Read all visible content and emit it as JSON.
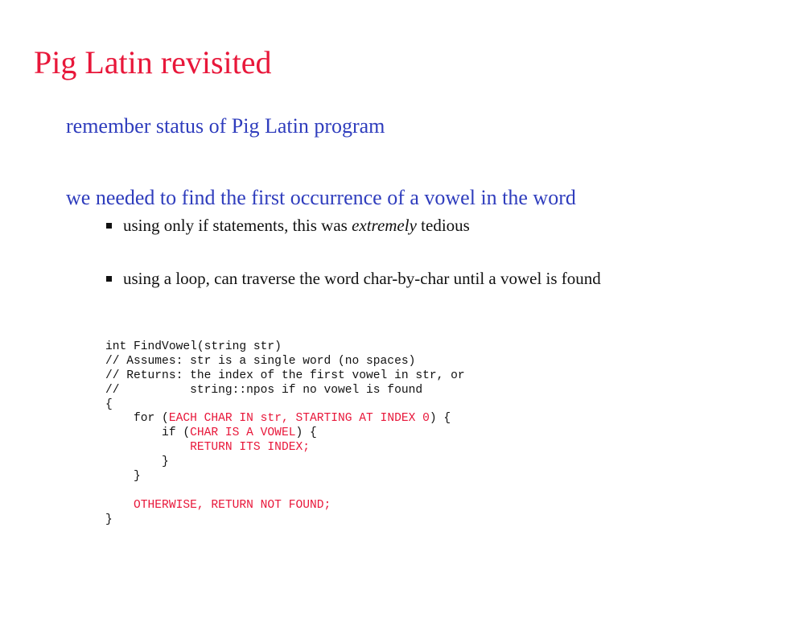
{
  "slide": {
    "title": "Pig Latin revisited",
    "bullets": [
      "remember status of Pig Latin program",
      "we needed to find the first occurrence of a vowel in the word"
    ],
    "sub_bullets": [
      {
        "before": "using only if statements, this was ",
        "emph": "extremely",
        "after": " tedious"
      },
      {
        "before": "using a loop, can traverse the word char-by-char until a vowel is found",
        "emph": "",
        "after": ""
      }
    ],
    "code": {
      "line1": "int FindVowel(string str)",
      "line2": "// Assumes: str is a single word (no spaces)",
      "line3": "// Returns: the index of the first vowel in str, or",
      "line4": "//          string::npos if no vowel is found",
      "line5": "{",
      "line6_a": "    for (",
      "line6_b": "EACH CHAR IN str, STARTING AT INDEX 0",
      "line6_c": ") {",
      "line7_a": "        if (",
      "line7_b": "CHAR IS A VOWEL",
      "line7_c": ") {",
      "line8_a": "            ",
      "line8_b": "RETURN ITS INDEX;",
      "line9": "        }",
      "line10": "    }",
      "line11": "",
      "line12_a": "    ",
      "line12_b": "OTHERWISE, RETURN NOT FOUND;",
      "line13": "}"
    },
    "colors": {
      "title": "#e8173a",
      "bullet": "#2f3dbd",
      "pseudocode": "#e8173a",
      "text": "#111111"
    }
  }
}
